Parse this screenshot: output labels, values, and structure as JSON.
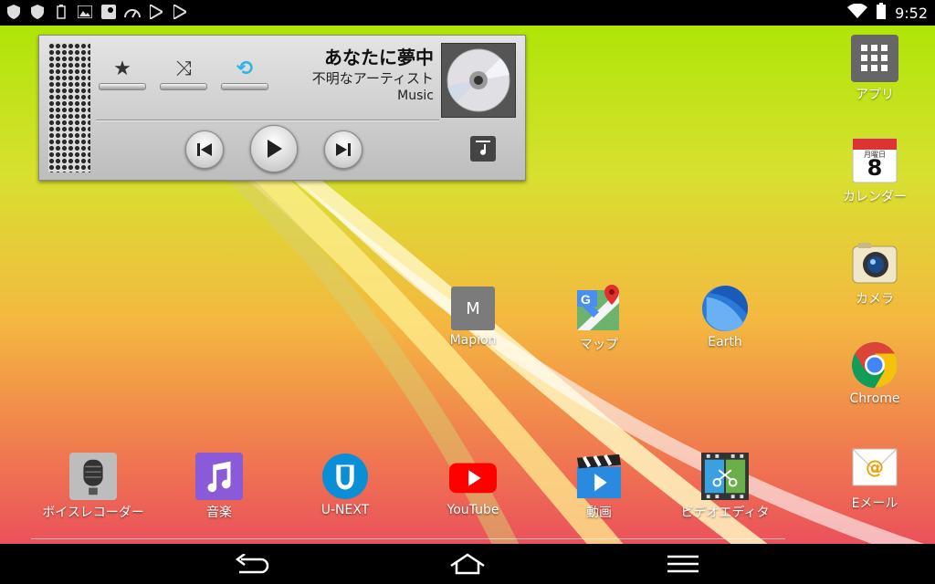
{
  "status_bar": {
    "left_icons": [
      "shield-icon",
      "shield-icon",
      "battery-saver-icon",
      "gallery-icon",
      "maps-notification-icon",
      "speedometer-icon",
      "play-store-icon",
      "play-store-icon"
    ],
    "right_icons": [
      "wifi-icon",
      "battery-icon"
    ],
    "time": "9:52"
  },
  "music_widget": {
    "title": "あなたに夢中",
    "artist": "不明なアーティスト",
    "album": "Music",
    "favorite_glyph": "★",
    "shuffle_glyph": "⤨",
    "repeat_glyph": "⟲",
    "repeat_color": "#2ab4e8"
  },
  "apps": {
    "apps_drawer": "アプリ",
    "calendar": "カレンダー",
    "calendar_day_label": "月曜日",
    "calendar_date": "8",
    "camera": "カメラ",
    "chrome": "Chrome",
    "email": "Eメール",
    "email_glyph": "@",
    "mapion": "Mapion",
    "mapion_letter": "M",
    "maps": "マップ",
    "earth": "Earth",
    "voice_recorder": "ボイスレコーダー",
    "music": "音楽",
    "unext": "U-NEXT",
    "youtube": "YouTube",
    "video": "動画",
    "video_editor": "ビデオエディタ"
  },
  "colors": {
    "youtube_red": "#ff0000",
    "unext_blue": "#0a8fd6",
    "music_purple": "#8a5ad8",
    "chrome_red": "#db4437",
    "chrome_yellow": "#f4c20d",
    "chrome_green": "#0f9d58",
    "chrome_blue": "#4285f4"
  }
}
